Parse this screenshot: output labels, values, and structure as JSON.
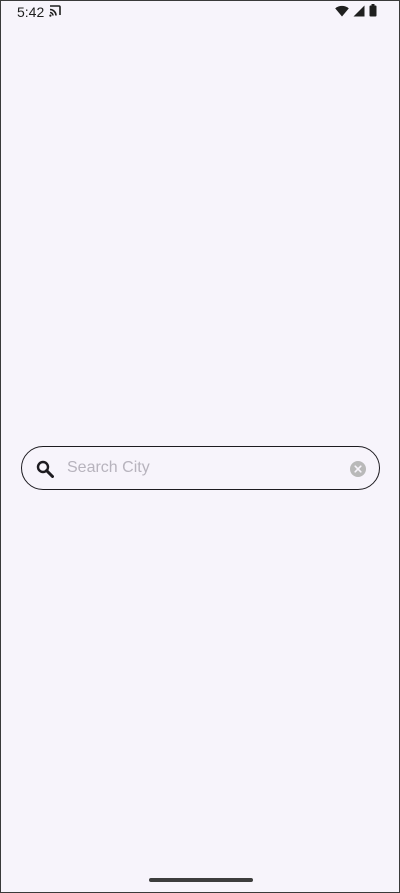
{
  "status_bar": {
    "time": "5:42",
    "left_icons": [
      "cast-icon"
    ],
    "right_icons": [
      "wifi-icon",
      "signal-icon",
      "battery-icon"
    ]
  },
  "search": {
    "placeholder": "Search City",
    "value": "",
    "leading_icon": "search-icon",
    "trailing_icon": "clear-icon"
  },
  "colors": {
    "background": "#f7f4fb",
    "outline": "#1d1b20",
    "placeholder": "#b7b3bd",
    "clear_icon": "#b9b9b9"
  }
}
